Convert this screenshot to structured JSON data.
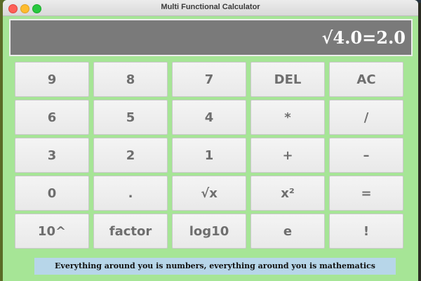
{
  "window": {
    "title": "Multi Functional Calculator"
  },
  "display": {
    "text": "√4.0=2.0"
  },
  "keys": [
    {
      "label": "9",
      "name": "key-9"
    },
    {
      "label": "8",
      "name": "key-8"
    },
    {
      "label": "7",
      "name": "key-7"
    },
    {
      "label": "DEL",
      "name": "key-delete"
    },
    {
      "label": "AC",
      "name": "key-all-clear"
    },
    {
      "label": "6",
      "name": "key-6"
    },
    {
      "label": "5",
      "name": "key-5"
    },
    {
      "label": "4",
      "name": "key-4"
    },
    {
      "label": "*",
      "name": "key-multiply"
    },
    {
      "label": "/",
      "name": "key-divide"
    },
    {
      "label": "3",
      "name": "key-3"
    },
    {
      "label": "2",
      "name": "key-2"
    },
    {
      "label": "1",
      "name": "key-1"
    },
    {
      "label": "+",
      "name": "key-add"
    },
    {
      "label": "–",
      "name": "key-subtract"
    },
    {
      "label": "0",
      "name": "key-0"
    },
    {
      "label": ".",
      "name": "key-decimal"
    },
    {
      "label": "√x",
      "name": "key-sqrt"
    },
    {
      "label": "x²",
      "name": "key-square"
    },
    {
      "label": "=",
      "name": "key-equals"
    },
    {
      "label": "10^",
      "name": "key-power-of-ten"
    },
    {
      "label": "factor",
      "name": "key-factor"
    },
    {
      "label": "log10",
      "name": "key-log10"
    },
    {
      "label": "e",
      "name": "key-e"
    },
    {
      "label": "!",
      "name": "key-factorial"
    }
  ],
  "footer": {
    "text": "Everything around you is numbers, everything around you is mathematics"
  },
  "colors": {
    "window_bg": "#a6e596",
    "display_bg": "#7a7a7a",
    "key_bg": "#f0f0f0",
    "key_text": "#6e6e6e",
    "footer_bg": "#b7d6e9"
  }
}
